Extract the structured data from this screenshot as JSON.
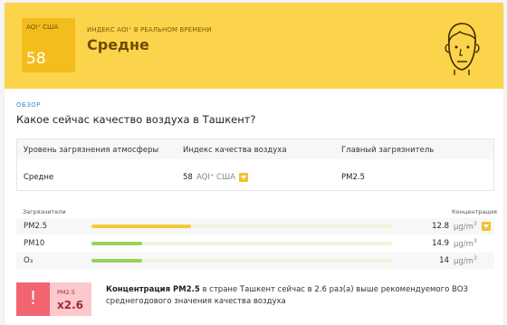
{
  "banner": {
    "aqi_label": "AQI⁺ США",
    "aqi_value": "58",
    "subtitle": "ИНДЕКС AQI⁺ В РЕАЛЬНОМ ВРЕМЕНИ",
    "status": "Средне",
    "face_icon": "neutral-face-icon",
    "colors": {
      "banner": "#fbd44b",
      "aqi_box": "#f2bd1d",
      "title": "#6d4d00"
    }
  },
  "overview": {
    "tag": "ОБЗОР",
    "title": "Какое сейчас качество воздуха в Ташкент?"
  },
  "summary": {
    "headers": [
      "Уровень загрязнения атмосферы",
      "Индекс качества воздуха",
      "Главный загрязнитель"
    ],
    "level": "Средне",
    "aqi_value": "58",
    "aqi_unit": "AQI⁺ США",
    "main_pollutant": "PM2.5"
  },
  "pollutants": {
    "header_left": "Загрязнители",
    "header_right": "Концентрация",
    "unit_main": "µg/m",
    "unit_exp": "3",
    "rows": [
      {
        "name": "PM2.5",
        "value": "12.8",
        "level": 0.33,
        "color": "#f6c93b",
        "has_dropdown": true
      },
      {
        "name": "PM10",
        "value": "14.9",
        "level": 0.17,
        "color": "#9ad35a",
        "has_dropdown": false
      },
      {
        "name": "O₃",
        "value": "14",
        "level": 0.17,
        "color": "#9ad35a",
        "has_dropdown": false
      }
    ]
  },
  "alert": {
    "icon": "exclamation-icon",
    "pollutant": "PM2.5",
    "multiplier": "x2.6",
    "text_bold": "Концентрация PM2.5",
    "text_rest": " в стране Ташкент сейчас в 2.6 раз(а) выше рекомендуемого ВОЗ среднегодового значения качества воздуха",
    "colors": {
      "dark": "#f2646f",
      "light": "#fbc8cc"
    }
  }
}
